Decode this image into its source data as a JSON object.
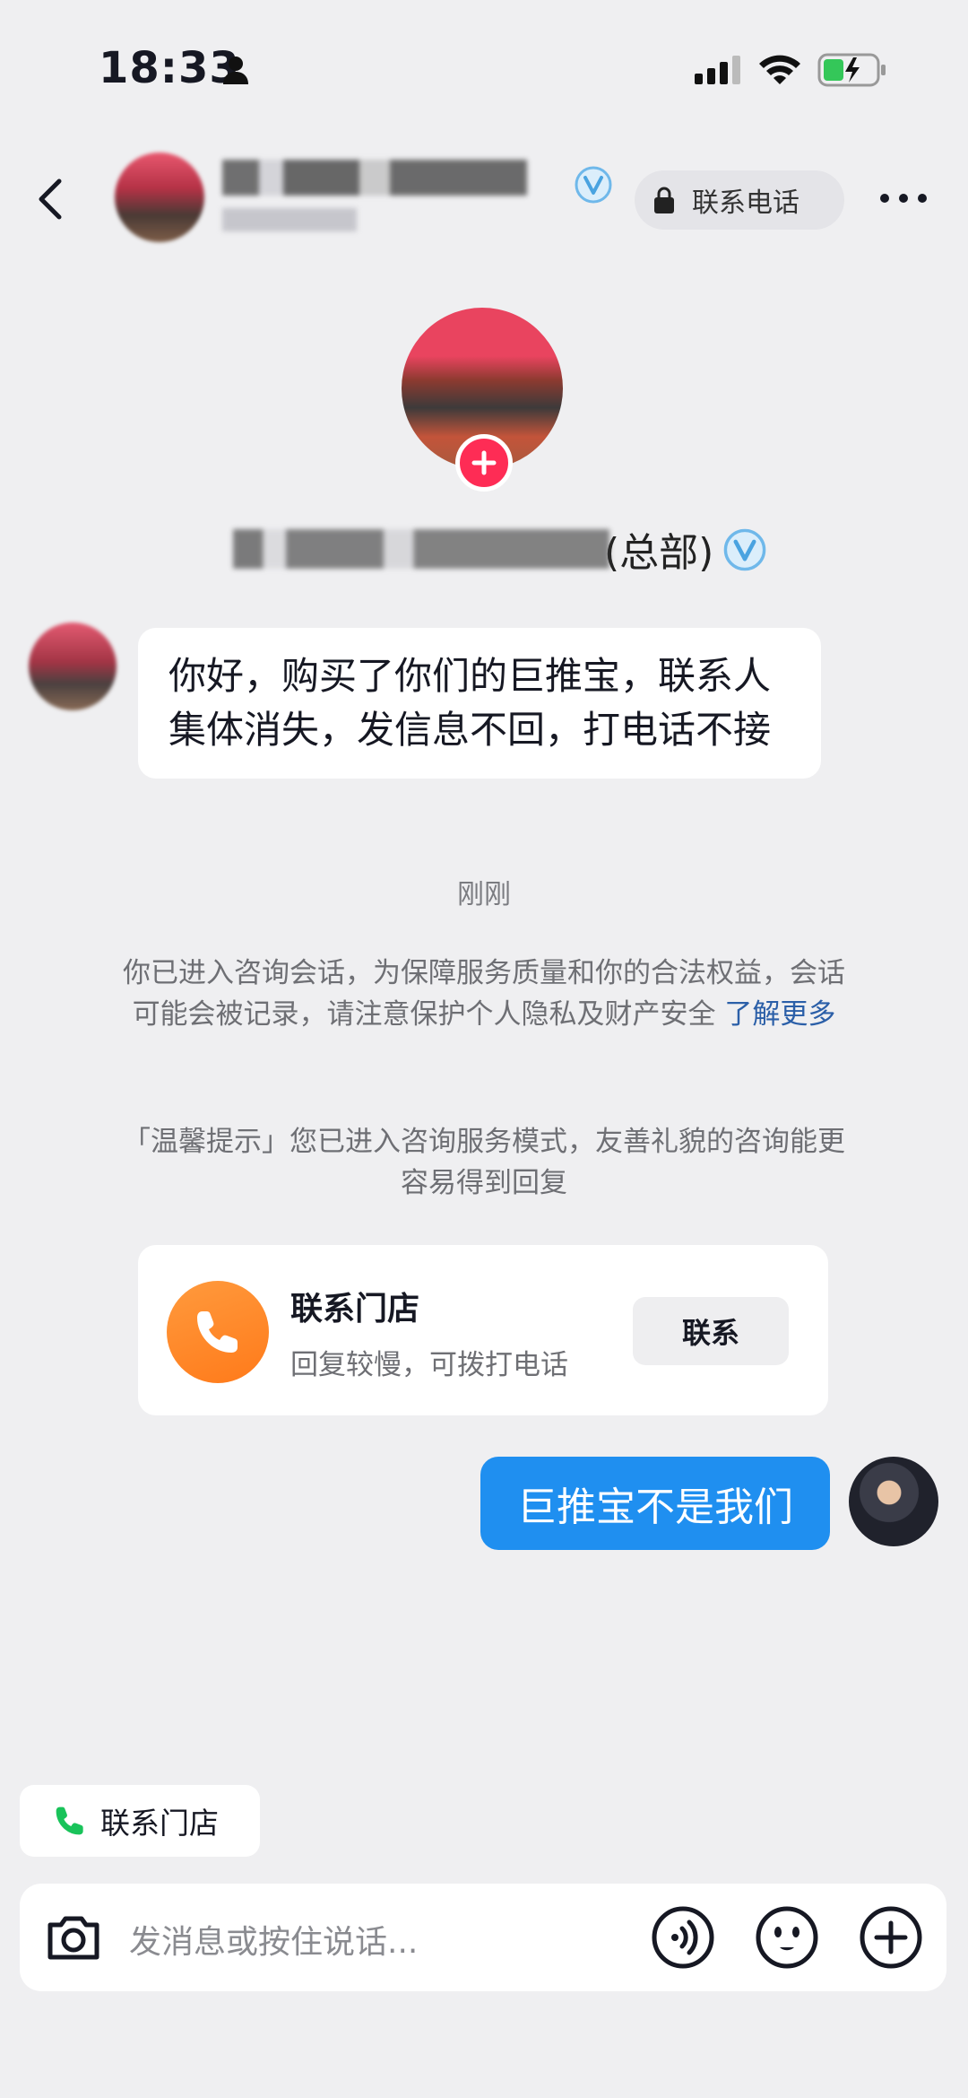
{
  "status_bar": {
    "time": "18:33"
  },
  "header": {
    "phone_label": "联系电话"
  },
  "profile": {
    "name_suffix": "(总部)"
  },
  "messages": {
    "incoming_text": "你好，购买了你们的巨推宝，联系人集体消失，发信息不回，打电话不接",
    "time_label": "刚刚",
    "notice_text": "你已进入咨询会话，为保障服务质量和你的合法权益，会话可能会被记录，请注意保护个人隐私及财产安全",
    "notice_link": "了解更多",
    "tip_text": "「温馨提示」您已进入咨询服务模式，友善礼貌的咨询能更容易得到回复",
    "outgoing_text": "巨推宝不是我们"
  },
  "store_card": {
    "title": "联系门店",
    "subtitle": "回复较慢，可拨打电话",
    "button_label": "联系"
  },
  "bottom": {
    "chip_label": "联系门店",
    "input_placeholder": "发消息或按住说话..."
  },
  "colors": {
    "accent_blue": "#1f8ff0",
    "follow_red": "#fe2c55",
    "store_orange": "#ff8a2a",
    "link_blue": "#2b5fa8"
  }
}
